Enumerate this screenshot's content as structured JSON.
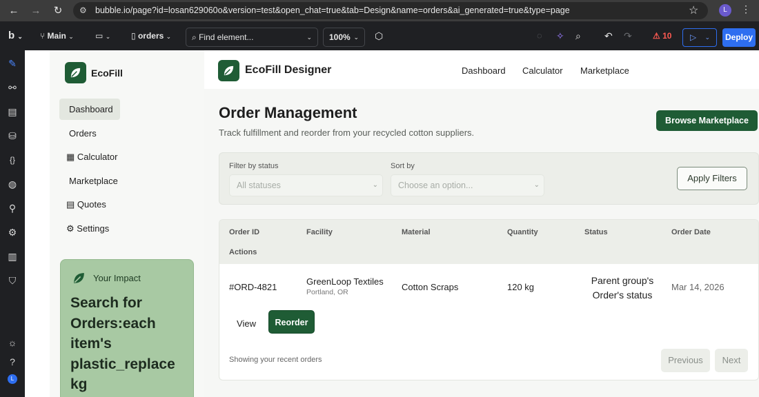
{
  "browser": {
    "url": "bubble.io/page?id=losan629060o&version=test&open_chat=true&tab=Design&name=orders&ai_generated=true&type=page",
    "profile_initial": "L"
  },
  "editor": {
    "logo": "b",
    "branch": "Main",
    "page_name": "orders",
    "find_placeholder": "Find element...",
    "zoom": "100%",
    "issues_count": "10",
    "deploy_label": "Deploy",
    "user_initial": "L"
  },
  "app": {
    "brand": "EcoFill",
    "designer_brand": "EcoFill Designer",
    "sidebar": {
      "items": [
        {
          "label": "Dashboard",
          "icon": ""
        },
        {
          "label": "Orders",
          "icon": ""
        },
        {
          "label": "Calculator",
          "icon": "calculator-icon"
        },
        {
          "label": "Marketplace",
          "icon": ""
        },
        {
          "label": "Quotes",
          "icon": "document-icon"
        },
        {
          "label": "Settings",
          "icon": "gear-icon"
        }
      ]
    },
    "impact": {
      "title": "Your Impact",
      "text": "Search for Orders:each item's plastic_replace kg"
    },
    "topnav": [
      "Dashboard",
      "Calculator",
      "Marketplace"
    ],
    "header": {
      "title": "Order Management",
      "subtitle": "Track fulfillment and reorder from your recycled cotton suppliers.",
      "browse_label": "Browse Marketplace"
    },
    "filters": {
      "status_label": "Filter by status",
      "status_value": "All statuses",
      "sort_label": "Sort by",
      "sort_value": "Choose an option...",
      "apply_label": "Apply Filters"
    },
    "table": {
      "columns": [
        "Order ID",
        "Facility",
        "Material",
        "Quantity",
        "Status",
        "Order Date",
        "Actions"
      ],
      "rows": [
        {
          "order_id": "#ORD-4821",
          "facility": "GreenLoop Textiles",
          "location": "Portland, OR",
          "material": "Cotton Scraps",
          "quantity": "120 kg",
          "status": "Parent group's Order's status",
          "date": "Mar 14, 2026",
          "view_label": "View",
          "reorder_label": "Reorder"
        }
      ],
      "footer": "Showing your recent orders",
      "prev_label": "Previous",
      "next_label": "Next"
    }
  },
  "colors": {
    "brand_green": "#1f5c35",
    "impact_bg": "#a8c9a3",
    "deploy_blue": "#2e6ef0"
  }
}
